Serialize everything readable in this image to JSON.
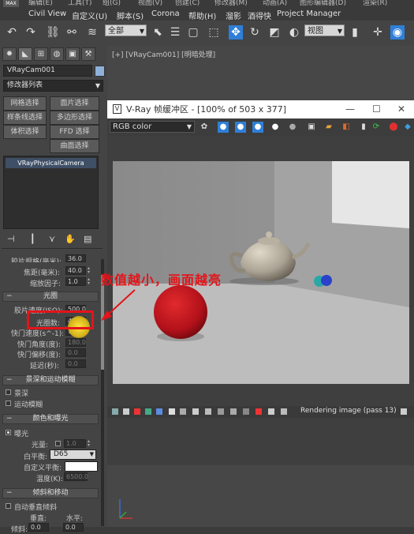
{
  "menubar": {
    "logo": "MAX",
    "top_items": [
      "编辑(E)",
      "工具(T)",
      "组(G)",
      "视图(V)",
      "创建(C)",
      "修改器(M)",
      "动画(A)",
      "图形编辑器(D)",
      "渲染(R)"
    ],
    "items": [
      "Civil View",
      "自定义(U)",
      "脚本(S)",
      "Corona",
      "帮助(H)",
      "溜影",
      "酒得快",
      "Project Manager"
    ]
  },
  "toolbar": {
    "selection_filter": "全部",
    "view_dropdown": "视图"
  },
  "left_panel": {
    "object_name": "VRayCam001",
    "modifier_list": "修改器列表",
    "buttons": [
      "网格选择",
      "面片选择",
      "样条线选择",
      "多边形选择",
      "体积选择",
      "FFD 选择",
      "曲面选择"
    ],
    "stack_item": "VRayPhysicalCamera",
    "focal": {
      "cut_label": "胶片规格(毫米):",
      "cut_value": "36.0",
      "label": "焦距(毫米):",
      "value": "40.0"
    },
    "zoom": {
      "label": "缩放因子:",
      "value": "1.0"
    },
    "exposure_section": {
      "title": "光圈",
      "toggle": "−"
    },
    "film_speed": {
      "label": "胶片速度(ISO):",
      "value": "500.0"
    },
    "fnumber": {
      "label": "光圈数:",
      "value": "4.0"
    },
    "shutter_speed": {
      "label": "快门速度(s^-1):",
      "value": "100.0"
    },
    "shutter_angle": {
      "label": "快门角度(度):",
      "value": "180.0"
    },
    "shutter_offset": {
      "label": "快门偏移(度):",
      "value": "0.0"
    },
    "latency": {
      "label": "延迟(秒):",
      "value": "0.0"
    },
    "dof_section": {
      "title": "景深和运动模糊",
      "toggle": "−"
    },
    "dof_label": "景深",
    "motion_blur_label": "运动模糊",
    "color_section": {
      "title": "颜色和曝光",
      "toggle": "−"
    },
    "exposure_label": "曝光",
    "light_label": "光量:",
    "light_value": "1.0",
    "white_balance": {
      "label": "白平衡:",
      "value": "D65"
    },
    "custom_wb_label": "自定义平衡:",
    "temperature": {
      "label": "温度(K):",
      "value": "6500.0"
    },
    "tilt_section": {
      "title": "倾斜和移动",
      "toggle": "−"
    },
    "auto_vertical_label": "自动垂直倾斜",
    "vertical_label": "垂直:",
    "horizontal_label": "水平:",
    "tilt_label": "倾斜:",
    "tilt_value": "0.0",
    "shift_value": "0.0"
  },
  "viewport": {
    "label": "[+] [VRayCam001] [明暗处理]"
  },
  "vfb": {
    "title": "V-Ray 帧缓冲区 - [100% of 503 x 377]",
    "channel": "RGB color",
    "status": "Rendering image (pass 13)",
    "window_controls": [
      "—",
      "☐",
      "✕"
    ]
  },
  "annotation": {
    "text": "数值越小，画面越亮",
    "color": "#e3141a"
  }
}
